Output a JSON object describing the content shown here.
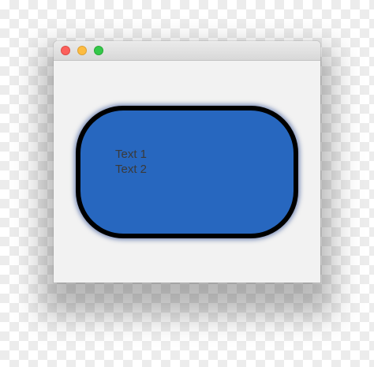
{
  "window": {
    "traffic_lights": {
      "close_color": "#fc605c",
      "minimize_color": "#fdbc40",
      "zoom_color": "#34c84a"
    }
  },
  "content": {
    "shape": {
      "fill_color": "#2767bf",
      "border_color": "#000000",
      "lines": [
        "Text 1",
        "Text 2"
      ]
    }
  }
}
